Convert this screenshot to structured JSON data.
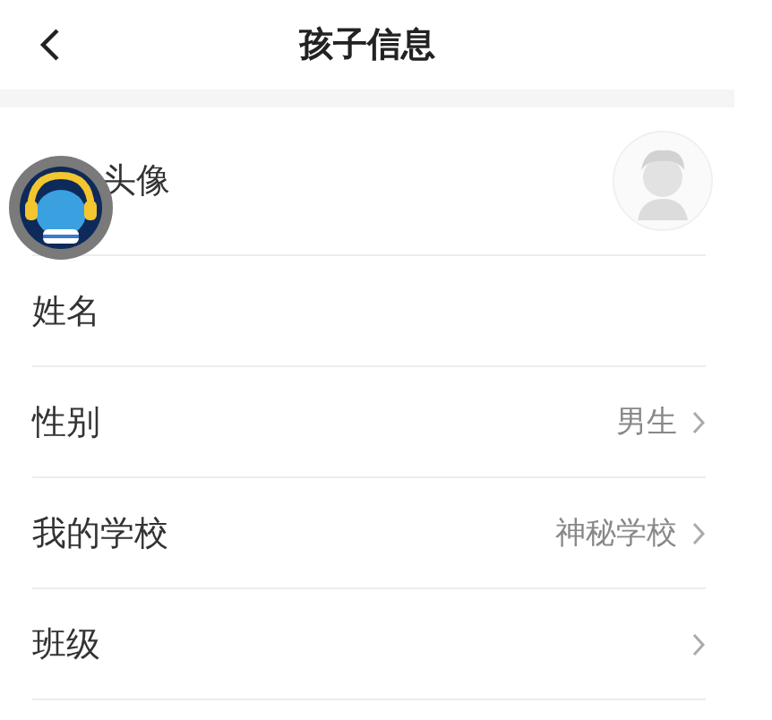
{
  "header": {
    "title": "孩子信息"
  },
  "rows": [
    {
      "kind": "avatar",
      "label": "头像"
    },
    {
      "kind": "field",
      "label": "姓名"
    },
    {
      "kind": "select",
      "label": "性别",
      "value": "男生"
    },
    {
      "kind": "select",
      "label": "我的学校",
      "value": "神秘学校"
    },
    {
      "kind": "select",
      "label": "班级"
    }
  ]
}
